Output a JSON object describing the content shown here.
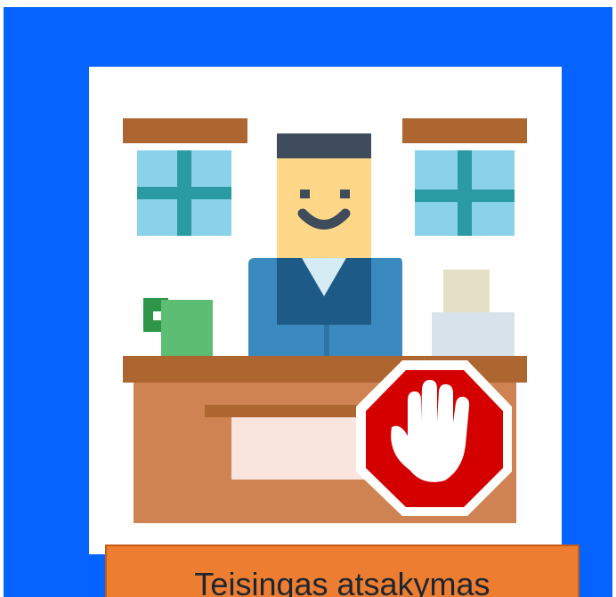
{
  "banner": {
    "label": "Teisingas atsakymas"
  },
  "colors": {
    "panel": "#0563ff",
    "banner": "#ed7d31",
    "stop_sign": "#d40000"
  },
  "icons": {
    "illustration": "office-receptionist-illustration",
    "stop_sign": "stop-hand-sign-icon"
  }
}
